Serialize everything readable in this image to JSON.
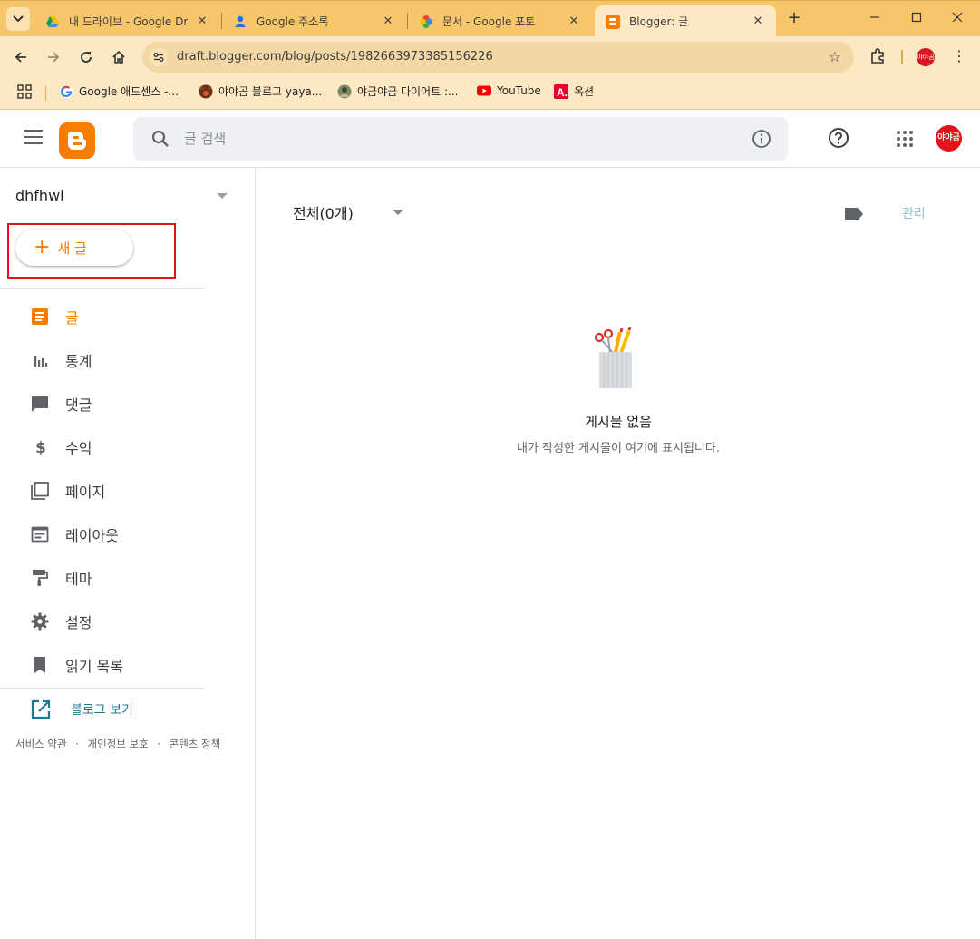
{
  "browser": {
    "tabs": [
      {
        "title": "내 드라이브 - Google Dr",
        "icon": "google-drive-icon",
        "active": false
      },
      {
        "title": "Google 주소록",
        "icon": "google-contacts-icon",
        "active": false
      },
      {
        "title": "문서 - Google 포토",
        "icon": "google-photos-icon",
        "active": false
      },
      {
        "title": "Blogger: 글",
        "icon": "blogger-icon",
        "active": true
      }
    ],
    "new_tab_label": "+",
    "url": "draft.blogger.com/blog/posts/1982663973385156226",
    "bookmarks": [
      {
        "label": "Google 애드센스 -...",
        "icon": "google-g-icon"
      },
      {
        "label": "야야곰 블로그 yaya...",
        "icon": "bear-avatar-icon"
      },
      {
        "label": "야금야금 다이어트 :...",
        "icon": "avatar-icon"
      },
      {
        "label": "YouTube",
        "icon": "youtube-icon"
      },
      {
        "label": "옥션",
        "icon": "auction-icon"
      }
    ],
    "profile_text": "야야곰"
  },
  "app": {
    "search_placeholder": "글 검색",
    "avatar_text": "야야곰",
    "brand_color": "#f57d00"
  },
  "sidebar": {
    "blog_name": "dhfhwl",
    "new_post_label": "새 글",
    "items": [
      {
        "label": "글",
        "icon": "posts-icon",
        "active": true
      },
      {
        "label": "통계",
        "icon": "stats-icon",
        "active": false
      },
      {
        "label": "댓글",
        "icon": "comments-icon",
        "active": false
      },
      {
        "label": "수익",
        "icon": "dollar-icon",
        "active": false
      },
      {
        "label": "페이지",
        "icon": "pages-icon",
        "active": false
      },
      {
        "label": "레이아웃",
        "icon": "layout-icon",
        "active": false
      },
      {
        "label": "테마",
        "icon": "paint-roller-icon",
        "active": false
      },
      {
        "label": "설정",
        "icon": "gear-icon",
        "active": false
      },
      {
        "label": "읽기 목록",
        "icon": "bookmark-icon",
        "active": false
      }
    ],
    "view_blog_label": "블로그 보기",
    "footer_links": [
      "서비스 약관",
      "개인정보 보호",
      "콘텐츠 정책"
    ],
    "footer_sep": "·"
  },
  "main": {
    "filter_label": "전체(0개)",
    "manage_label": "관리",
    "empty_title": "게시물 없음",
    "empty_subtitle": "내가 작성한 게시물이 여기에 표시됩니다."
  }
}
